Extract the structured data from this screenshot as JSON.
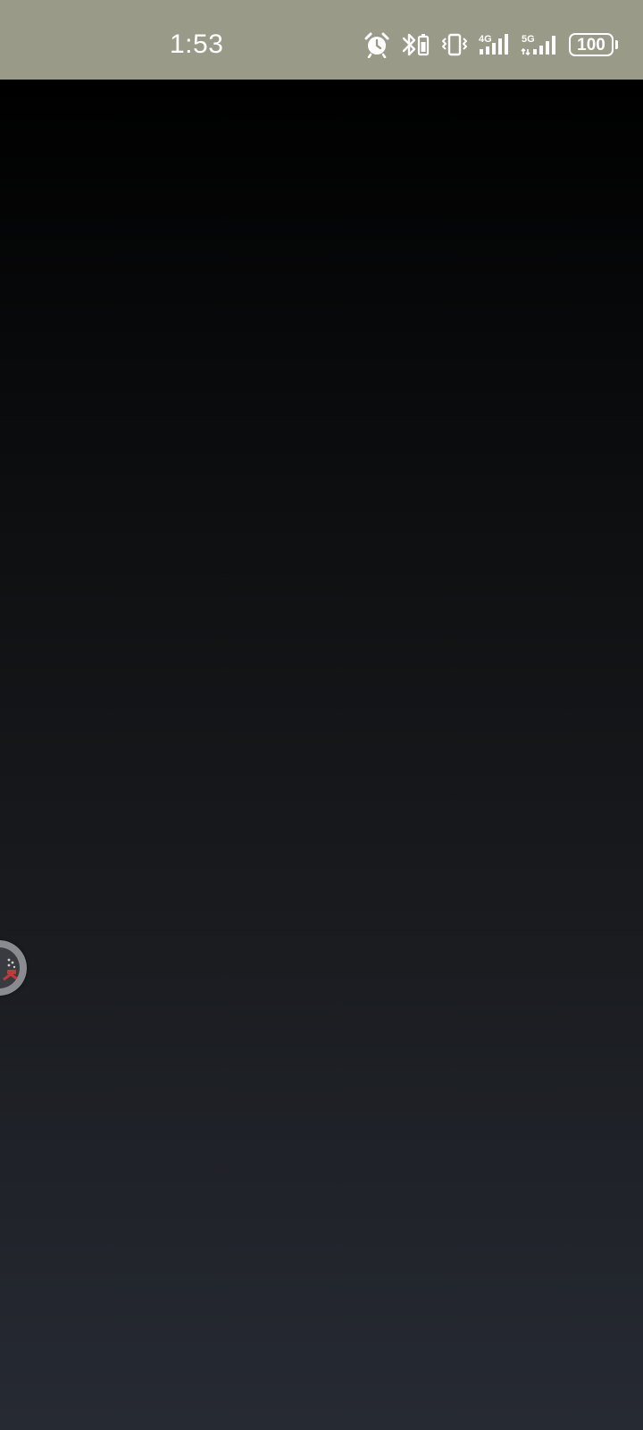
{
  "status_bar": {
    "time": "1:53",
    "icons": [
      "alarm-icon",
      "bluetooth-icon",
      "vibrate-icon",
      "signal-4g-icon",
      "signal-5g-icon"
    ],
    "network_labels": {
      "sim1": "4G",
      "sim2": "5G"
    },
    "battery_level": "100"
  },
  "colors": {
    "status_bar_bg": "#999a88",
    "screen_top": "#000000",
    "screen_bottom": "#262a33"
  },
  "floating_bubble": {
    "icon": "app-shortcut-icon"
  }
}
